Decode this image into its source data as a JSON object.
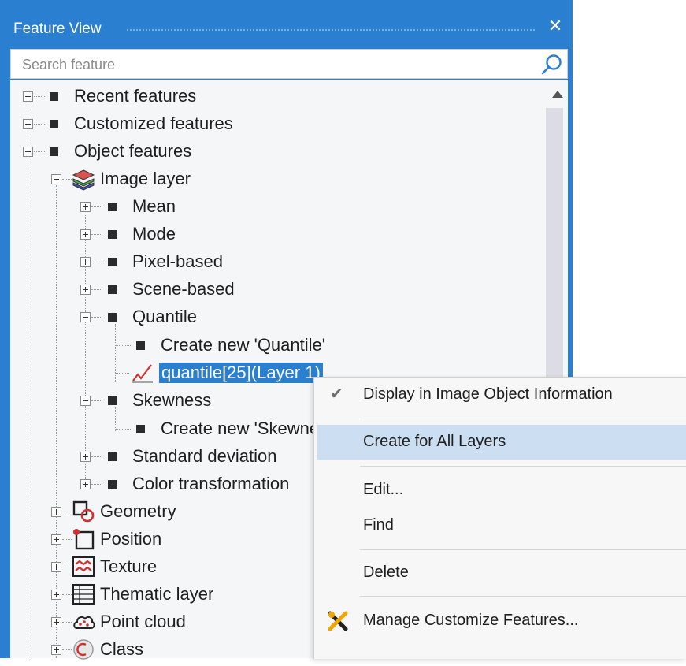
{
  "window": {
    "title": "Feature View"
  },
  "search": {
    "placeholder": "Search feature",
    "value": ""
  },
  "tree": {
    "recent": "Recent features",
    "customized": "Customized features",
    "object": "Object features",
    "image_layer": "Image layer",
    "mean": "Mean",
    "mode": "Mode",
    "pixel": "Pixel-based",
    "scene": "Scene-based",
    "quantile": "Quantile",
    "create_quantile": "Create new 'Quantile'",
    "quantile_item": "quantile[25](Layer 1)",
    "skewness": "Skewness",
    "create_skew": "Create new 'Skewness'",
    "stddev": "Standard deviation",
    "color_transform": "Color transformation",
    "geometry": "Geometry",
    "position": "Position",
    "texture": "Texture",
    "thematic": "Thematic layer",
    "pointcloud": "Point cloud",
    "class": "Class"
  },
  "context_menu": {
    "display": "Display in Image Object Information",
    "create_all": "Create for All Layers",
    "edit": "Edit...",
    "find": "Find",
    "delete": "Delete",
    "manage": "Manage Customize Features..."
  },
  "colors": {
    "accent": "#2a7fd1",
    "menu_highlight": "#ccdff2",
    "tree_bg": "#f5f6f8"
  }
}
